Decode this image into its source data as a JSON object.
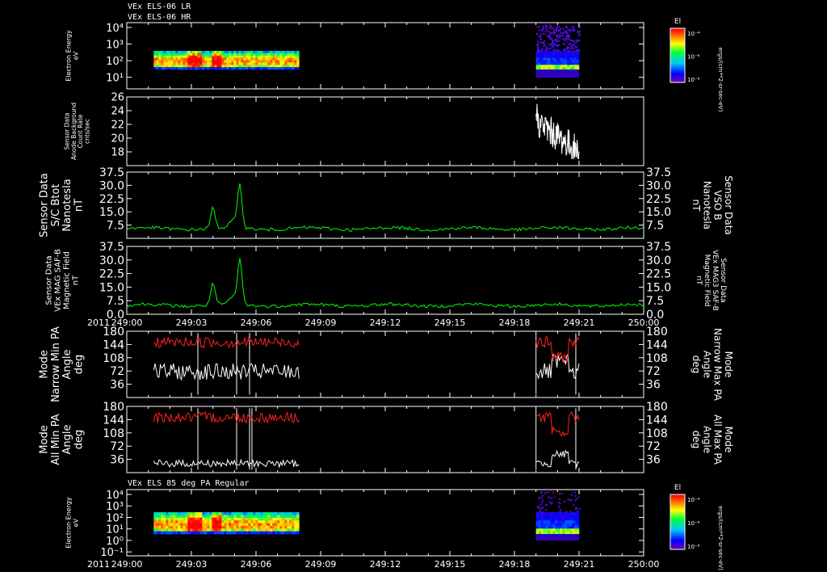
{
  "header": {
    "line1": "VEx ELS-06 LR",
    "line2": "VEx ELS-06 HR",
    "bottom_panel_title": "VEx ELS 85 deg PA Regular"
  },
  "time_axis": {
    "year": "2011",
    "ticks": [
      "249:00",
      "249:03",
      "249:06",
      "249:09",
      "249:12",
      "249:15",
      "249:18",
      "249:21",
      "250:00"
    ]
  },
  "colors": {
    "background": "#000000",
    "axis": "#ffffff",
    "green_trace": "#00ff00",
    "red_trace": "#ff2020",
    "white_trace": "#ffffff",
    "right_green_label": "#00ff00",
    "right_red_label": "#ff2020"
  },
  "colorbar": {
    "title": "El",
    "ticks": [
      "10⁻⁴",
      "10⁻⁶",
      "10⁻⁸"
    ],
    "unit_label": "ergs/(cm**2-sr-sec-eV)"
  },
  "chart_data": [
    {
      "type": "heatmap",
      "panel": "electron-energy-top",
      "ylabel": [
        "Electron Energy",
        "eV"
      ],
      "y_scale": "log",
      "y_ticks": [
        "10⁴",
        "10³",
        "10²",
        "10¹"
      ],
      "data_segments_time": [
        [
          "249:01:15",
          "249:08:00"
        ],
        [
          "249:19:00",
          "249:21:00"
        ]
      ]
    },
    {
      "type": "line",
      "panel": "anode-background",
      "ylabel": [
        "Sensor Data",
        "Anode Background",
        "Count Rate",
        "cnts/sec"
      ],
      "y_ticks": [
        "26",
        "24",
        "22",
        "20",
        "18"
      ],
      "ylim": [
        16,
        26
      ],
      "series": [
        {
          "color": "white",
          "x_range": [
            "249:19:00",
            "249:21:00"
          ],
          "y_range": [
            17,
            25
          ]
        }
      ]
    },
    {
      "type": "line",
      "panel": "sc-btot",
      "ylabel": [
        "Sensor Data",
        "S/C Btot",
        "Nanotesla",
        "nT"
      ],
      "right_label": [
        "Sensor Data",
        "VSO B",
        "Nanotesla",
        "nT"
      ],
      "y_ticks": [
        "37.5",
        "30.0",
        "22.5",
        "15.0",
        "7.5"
      ],
      "ylim": [
        0,
        37.5
      ],
      "series": [
        {
          "color": "green",
          "baseline": 5.5,
          "peaks": [
            {
              "t": "249:04:00",
              "v": 17
            },
            {
              "t": "249:05:15",
              "v": 30
            }
          ]
        }
      ]
    },
    {
      "type": "line",
      "panel": "mag-field",
      "ylabel": [
        "Sensor Data",
        "VEx MAG SAF-B",
        "Magnetic Field",
        "nT"
      ],
      "right_label": [
        "Sensor Data",
        "VEx MAG3 SAF-B",
        "Magnetic Field",
        "nT"
      ],
      "y_ticks": [
        "37.5",
        "30.0",
        "22.5",
        "15.0",
        "7.5",
        "0.0"
      ],
      "ylim": [
        0,
        37.5
      ],
      "series": [
        {
          "color": "green",
          "baseline": 5.0,
          "peaks": [
            {
              "t": "249:04:00",
              "v": 17
            },
            {
              "t": "249:05:15",
              "v": 30
            }
          ]
        }
      ]
    },
    {
      "type": "line",
      "panel": "narrow-pa",
      "ylabel": [
        "Mode",
        "Narrow Min PA",
        "Angle",
        "deg"
      ],
      "right_label": [
        "Mode",
        "Narrow Max PA",
        "Angle",
        "deg"
      ],
      "y_ticks": [
        "180",
        "144",
        "108",
        "72",
        "36"
      ],
      "ylim": [
        0,
        180
      ],
      "series": [
        {
          "name": "Min PA",
          "color": "white"
        },
        {
          "name": "Max PA",
          "color": "red"
        }
      ]
    },
    {
      "type": "line",
      "panel": "all-pa",
      "ylabel": [
        "Mode",
        "All Min PA",
        "Angle",
        "deg"
      ],
      "right_label": [
        "Mode",
        "All Max PA",
        "Angle",
        "deg"
      ],
      "y_ticks": [
        "180",
        "144",
        "108",
        "72",
        "36"
      ],
      "ylim": [
        0,
        180
      ],
      "series": [
        {
          "name": "Min PA",
          "color": "white"
        },
        {
          "name": "Max PA",
          "color": "red"
        }
      ]
    },
    {
      "type": "heatmap",
      "panel": "electron-energy-85deg",
      "ylabel": [
        "Electron Energy",
        "eV"
      ],
      "y_scale": "log",
      "y_ticks": [
        "10⁴",
        "10³",
        "10²",
        "10¹",
        "10⁰",
        "10⁻¹"
      ],
      "data_segments_time": [
        [
          "249:01:15",
          "249:08:00"
        ],
        [
          "249:19:00",
          "249:21:00"
        ]
      ]
    }
  ]
}
